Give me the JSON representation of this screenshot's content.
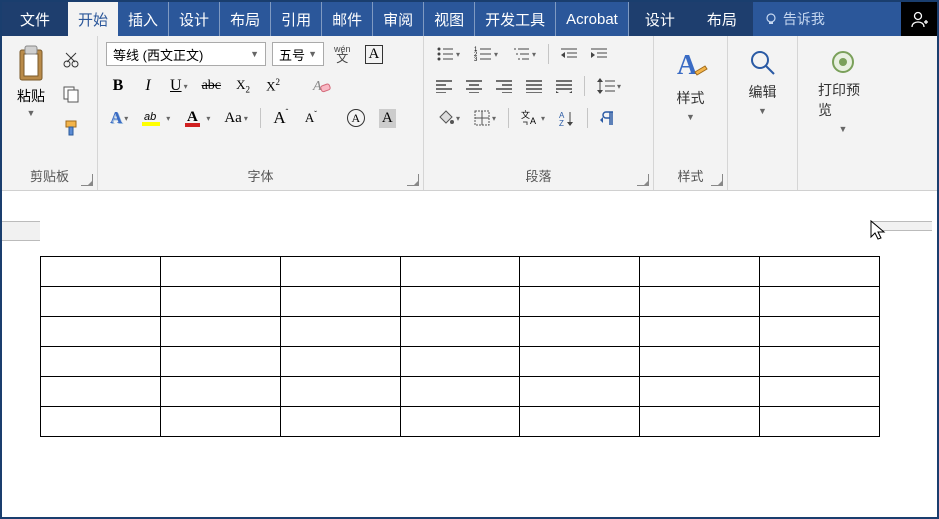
{
  "tabs": {
    "file": "文件",
    "home": "开始",
    "insert": "插入",
    "design": "设计",
    "layout": "布局",
    "references": "引用",
    "mailings": "邮件",
    "review": "审阅",
    "view": "视图",
    "developer": "开发工具",
    "acrobat": "Acrobat",
    "ctx_design": "设计",
    "ctx_layout": "布局",
    "tellme": "告诉我"
  },
  "clipboard": {
    "paste": "粘贴",
    "label": "剪贴板"
  },
  "font": {
    "name": "等线 (西文正文)",
    "size": "五号",
    "phonetic": "wén",
    "phonetic2": "文",
    "label": "字体"
  },
  "paragraph": {
    "label": "段落"
  },
  "styles": {
    "btn": "样式",
    "label": "样式"
  },
  "edit": {
    "label": "编辑"
  },
  "print": {
    "label": "打印预览"
  },
  "table": {
    "rows": 6,
    "cols": 7
  }
}
